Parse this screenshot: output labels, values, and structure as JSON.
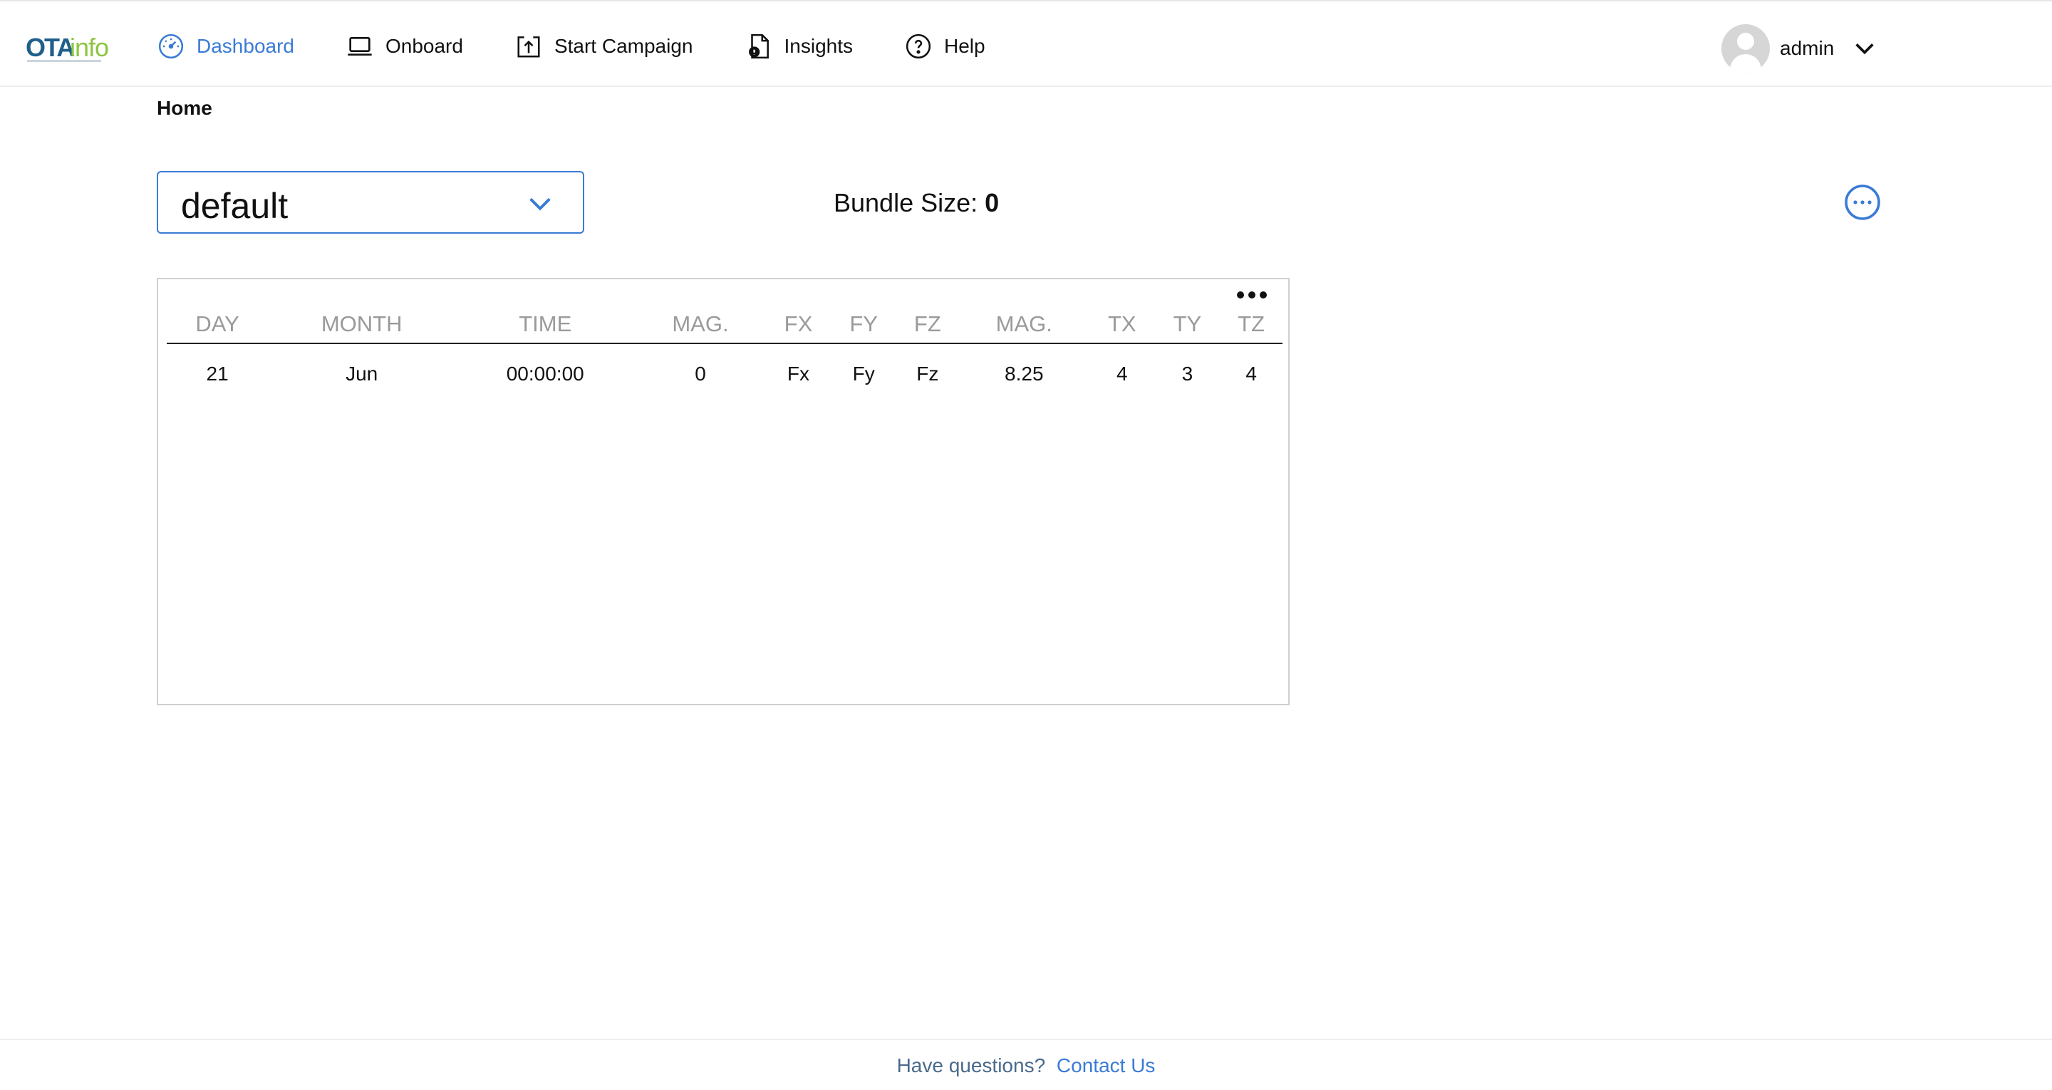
{
  "brand": {
    "logo_left": "OTA",
    "logo_right": "info"
  },
  "nav": {
    "items": [
      {
        "label": "Dashboard",
        "icon": "gauge-icon",
        "active": true
      },
      {
        "label": "Onboard",
        "icon": "laptop-icon"
      },
      {
        "label": "Start Campaign",
        "icon": "upload-box-icon"
      },
      {
        "label": "Insights",
        "icon": "document-alert-icon"
      },
      {
        "label": "Help",
        "icon": "question-circle-icon"
      }
    ]
  },
  "user": {
    "name": "admin"
  },
  "breadcrumb": {
    "current": "Home"
  },
  "bundle_select": {
    "value": "default"
  },
  "bundle_size": {
    "label": "Bundle Size:",
    "value": "0"
  },
  "table": {
    "columns": [
      "DAY",
      "MONTH",
      "TIME",
      "MAG.",
      "FX",
      "FY",
      "FZ",
      "MAG.",
      "TX",
      "TY",
      "TZ"
    ],
    "rows": [
      [
        "21",
        "Jun",
        "00:00:00",
        "0",
        "Fx",
        "Fy",
        "Fz",
        "8.25",
        "4",
        "3",
        "4"
      ]
    ]
  },
  "footer": {
    "question": "Have questions?",
    "link": "Contact Us"
  },
  "colors": {
    "accent": "#3a7bd5",
    "logo_blue": "#1f5f8b",
    "logo_green": "#8cc63f",
    "header_text": "#9a9a9a"
  }
}
